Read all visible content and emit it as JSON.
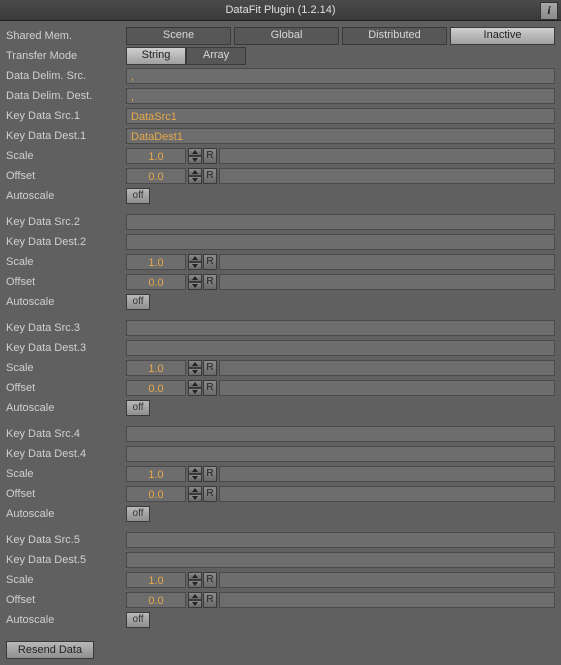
{
  "window": {
    "title": "DataFit Plugin (1.2.14)",
    "info_tooltip": "i"
  },
  "labels": {
    "shared_mem": "Shared Mem.",
    "transfer_mode": "Transfer Mode",
    "delim_src": "Data Delim. Src.",
    "delim_dest": "Data Delim. Dest.",
    "scale": "Scale",
    "offset": "Offset",
    "autoscale": "Autoscale",
    "reset": "R",
    "resend": "Resend Data"
  },
  "shared_mem": {
    "options": [
      "Scene",
      "Global",
      "Distributed",
      "Inactive"
    ],
    "active": "Inactive"
  },
  "transfer_mode": {
    "options": [
      "String",
      "Array"
    ],
    "active": "String"
  },
  "delim": {
    "src": ",",
    "dest": ","
  },
  "autoscale_off": "off",
  "channels": [
    {
      "idx": 1,
      "src_label": "Key Data Src.1",
      "dest_label": "Key Data Dest.1",
      "src": "DataSrc1",
      "dest": "DataDest1",
      "scale": "1.0",
      "offset": "0.0",
      "autoscale": "off"
    },
    {
      "idx": 2,
      "src_label": "Key Data Src.2",
      "dest_label": "Key Data Dest.2",
      "src": "",
      "dest": "",
      "scale": "1.0",
      "offset": "0.0",
      "autoscale": "off"
    },
    {
      "idx": 3,
      "src_label": "Key Data Src.3",
      "dest_label": "Key Data Dest.3",
      "src": "",
      "dest": "",
      "scale": "1.0",
      "offset": "0.0",
      "autoscale": "off"
    },
    {
      "idx": 4,
      "src_label": "Key Data Src.4",
      "dest_label": "Key Data Dest.4",
      "src": "",
      "dest": "",
      "scale": "1.0",
      "offset": "0.0",
      "autoscale": "off"
    },
    {
      "idx": 5,
      "src_label": "Key Data Src.5",
      "dest_label": "Key Data Dest.5",
      "src": "",
      "dest": "",
      "scale": "1.0",
      "offset": "0.0",
      "autoscale": "off"
    }
  ]
}
